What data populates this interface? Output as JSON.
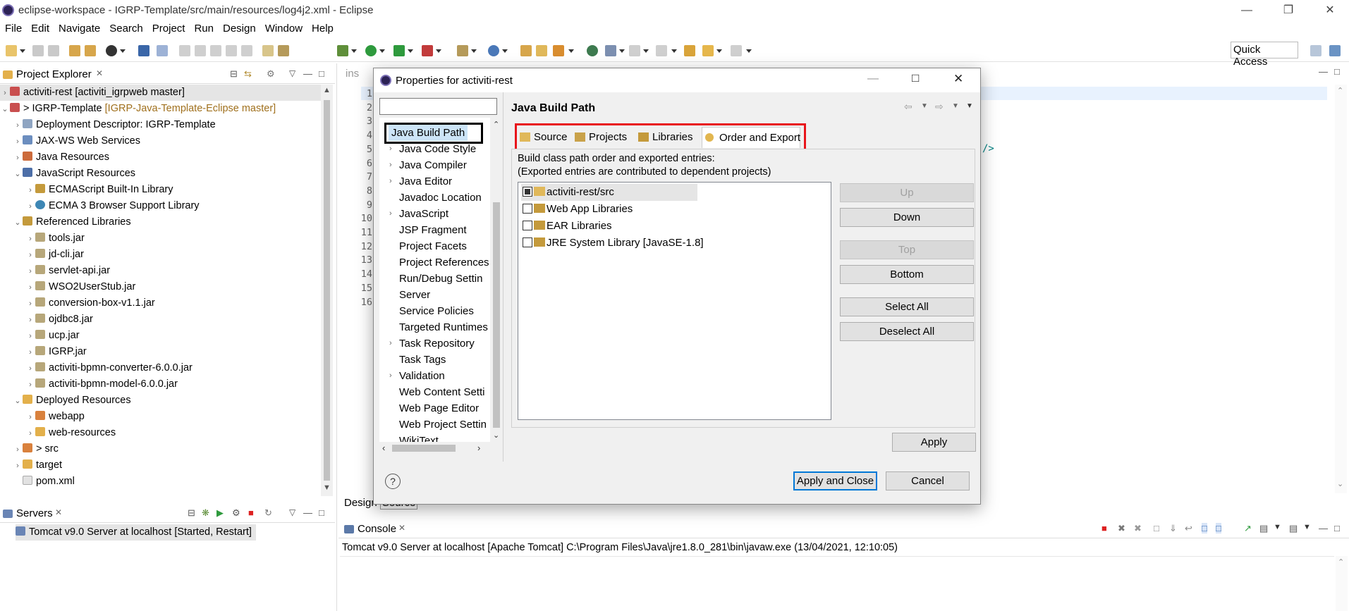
{
  "window": {
    "title": "eclipse-workspace - IGRP-Template/src/main/resources/log4j2.xml - Eclipse"
  },
  "menu": [
    "File",
    "Edit",
    "Navigate",
    "Search",
    "Project",
    "Run",
    "Design",
    "Window",
    "Help"
  ],
  "toolbar": {
    "quick_access": "Quick Access"
  },
  "project_explorer": {
    "title": "Project Explorer",
    "items": [
      {
        "label": "activiti-rest [activiti_igrpweb master]",
        "icon": "project-icon"
      },
      {
        "label": "> IGRP-Template",
        "extra": "[IGRP-Java-Template-Eclipse master]",
        "icon": "project-icon"
      },
      {
        "label": "Deployment Descriptor: IGRP-Template",
        "icon": "descriptor-icon"
      },
      {
        "label": "JAX-WS Web Services",
        "icon": "webservice-icon"
      },
      {
        "label": "Java Resources",
        "icon": "java-resources-icon"
      },
      {
        "label": "JavaScript Resources",
        "icon": "js-resources-icon"
      },
      {
        "label": "ECMAScript Built-In Library",
        "icon": "library-icon"
      },
      {
        "label": "ECMA 3 Browser Support Library",
        "icon": "globe-icon"
      },
      {
        "label": "Referenced Libraries",
        "icon": "library-icon"
      },
      {
        "label": "tools.jar",
        "icon": "jar-icon"
      },
      {
        "label": "jd-cli.jar",
        "icon": "jar-icon"
      },
      {
        "label": "servlet-api.jar",
        "icon": "jar-icon"
      },
      {
        "label": "WSO2UserStub.jar",
        "icon": "jar-icon"
      },
      {
        "label": "conversion-box-v1.1.jar",
        "icon": "jar-icon"
      },
      {
        "label": "ojdbc8.jar",
        "icon": "jar-icon"
      },
      {
        "label": "ucp.jar",
        "icon": "jar-icon"
      },
      {
        "label": "IGRP.jar",
        "icon": "jar-icon"
      },
      {
        "label": "activiti-bpmn-converter-6.0.0.jar",
        "icon": "jar-icon"
      },
      {
        "label": "activiti-bpmn-model-6.0.0.jar",
        "icon": "jar-icon"
      },
      {
        "label": "Deployed Resources",
        "icon": "folder-icon"
      },
      {
        "label": "webapp",
        "icon": "folder-icon"
      },
      {
        "label": "web-resources",
        "icon": "folder-icon"
      },
      {
        "label": "> src",
        "icon": "folder-icon"
      },
      {
        "label": "target",
        "icon": "folder-icon"
      },
      {
        "label": "pom.xml",
        "icon": "xml-file-icon"
      }
    ]
  },
  "servers": {
    "title": "Servers",
    "entry": "Tomcat v9.0 Server at localhost  [Started, Restart]"
  },
  "editor": {
    "tab_stub": "ins",
    "line_numbers": [
      "1",
      "2",
      "3",
      "4",
      "5",
      "6",
      "7",
      "8",
      "9",
      "10",
      "11",
      "12",
      "13",
      "14",
      "15",
      "16"
    ],
    "code_fragment": "/>",
    "bottom_tabs": [
      "Design",
      "Source"
    ]
  },
  "console": {
    "title": "Console",
    "text": "Tomcat v9.0 Server at localhost [Apache Tomcat] C:\\Program Files\\Java\\jre1.8.0_281\\bin\\javaw.exe (13/04/2021, 12:10:05)"
  },
  "dialog": {
    "title": "Properties for activiti-rest",
    "filter_value": "",
    "nav_items": [
      {
        "label": "Java Build Path",
        "selected": true
      },
      {
        "label": "Java Code Style",
        "expandable": true
      },
      {
        "label": "Java Compiler",
        "expandable": true
      },
      {
        "label": "Java Editor",
        "expandable": true
      },
      {
        "label": "Javadoc Location"
      },
      {
        "label": "JavaScript",
        "expandable": true
      },
      {
        "label": "JSP Fragment"
      },
      {
        "label": "Project Facets"
      },
      {
        "label": "Project References"
      },
      {
        "label": "Run/Debug Settin"
      },
      {
        "label": "Server"
      },
      {
        "label": "Service Policies"
      },
      {
        "label": "Targeted Runtimes"
      },
      {
        "label": "Task Repository",
        "expandable": true
      },
      {
        "label": "Task Tags"
      },
      {
        "label": "Validation",
        "expandable": true
      },
      {
        "label": "Web Content Setti"
      },
      {
        "label": "Web Page Editor"
      },
      {
        "label": "Web Project Settin"
      },
      {
        "label": "WikiText"
      }
    ],
    "page_title": "Java Build Path",
    "tabs": [
      "Source",
      "Projects",
      "Libraries",
      "Order and Export"
    ],
    "active_tab": "Order and Export",
    "description_line1": "Build class path order and exported entries:",
    "description_line2": "(Exported entries are contributed to dependent projects)",
    "entries": [
      {
        "label": "activiti-rest/src",
        "checked": true,
        "selected": true
      },
      {
        "label": "Web App Libraries",
        "checked": false
      },
      {
        "label": "EAR Libraries",
        "checked": false
      },
      {
        "label": "JRE System Library [JavaSE-1.8]",
        "checked": false
      }
    ],
    "buttons": {
      "up": "Up",
      "down": "Down",
      "top": "Top",
      "bottom": "Bottom",
      "select_all": "Select All",
      "deselect_all": "Deselect All",
      "apply": "Apply",
      "apply_close": "Apply and Close",
      "cancel": "Cancel",
      "help": "?"
    },
    "highlight_colors": {
      "selection_box": "#000000",
      "tab_box": "#e8141b"
    }
  }
}
